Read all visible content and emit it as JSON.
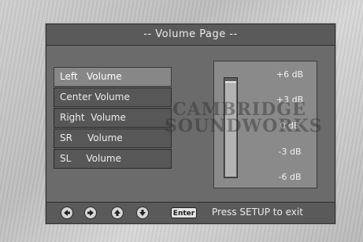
{
  "title": "-- Volume Page --",
  "menu": {
    "items": [
      {
        "label": "Left   Volume",
        "selected": true
      },
      {
        "label": "Center Volume",
        "selected": false
      },
      {
        "label": "Right  Volume",
        "selected": false
      },
      {
        "label": "SR     Volume",
        "selected": false
      },
      {
        "label": "SL     Volume",
        "selected": false
      }
    ]
  },
  "meter": {
    "level_fraction": 0.98,
    "scale": [
      "+6 dB",
      "+3 dB",
      "0 dB",
      "-3 dB",
      "-6 dB"
    ]
  },
  "watermark": {
    "line1": "CAMBRIDGE",
    "line2": "SOUNDWORKS"
  },
  "footer": {
    "nav_icons": [
      "left-arrow-icon",
      "right-arrow-icon",
      "up-arrow-icon",
      "down-arrow-icon"
    ],
    "enter_label": "Enter",
    "hint": "Press SETUP to exit"
  }
}
